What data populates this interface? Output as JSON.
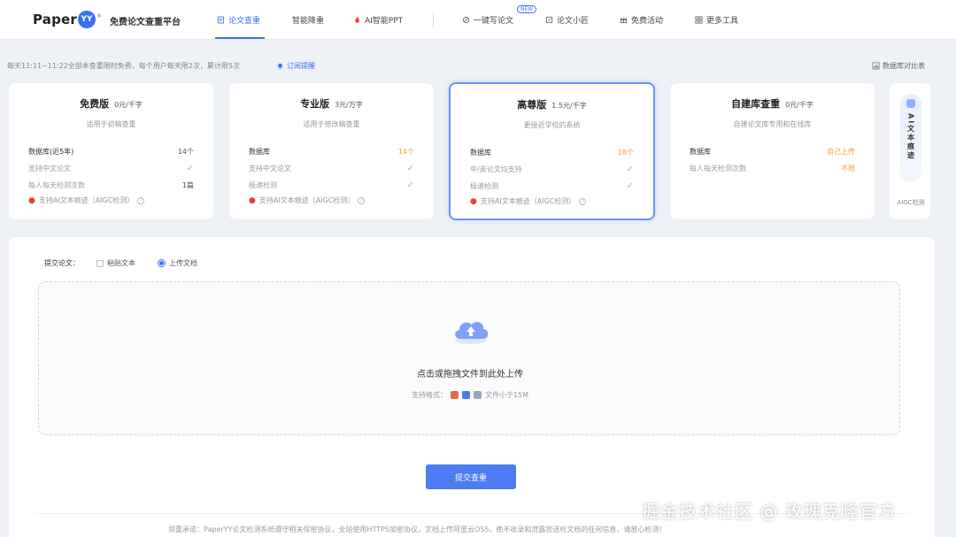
{
  "header": {
    "logo_text": "Paper",
    "logo_badge": "YY",
    "logo_reg": "®",
    "platform_name": "免费论文查重平台",
    "nav": [
      {
        "label": "论文查重",
        "icon": "document-icon",
        "active": true
      },
      {
        "label": "智能降重",
        "icon": "",
        "active": false
      },
      {
        "label": "AI智能PPT",
        "icon": "fire-icon",
        "active": false
      },
      {
        "label": "一键写论文",
        "icon": "pen-icon",
        "active": false,
        "badge": "NEW"
      },
      {
        "label": "论文小匠",
        "icon": "edit-icon",
        "active": false
      },
      {
        "label": "免费活动",
        "icon": "gift-icon",
        "active": false
      },
      {
        "label": "更多工具",
        "icon": "grid-icon",
        "active": false
      }
    ]
  },
  "notice": {
    "text": "每天11:11~11:22全部本查重限时免费，每个用户每天限2次，累计限5次",
    "link": "订阅提醒",
    "compare": "数据库对比表"
  },
  "cards": [
    {
      "title": "免费版",
      "price": "0元/千字",
      "subtitle": "适用于初稿查重",
      "rows": [
        {
          "k": "数据库(近5年)",
          "v": "14个",
          "strong": true,
          "vtype": "plain"
        },
        {
          "k": "支持中文论文",
          "v": "✓",
          "vtype": "check"
        },
        {
          "k": "每人每天检测次数",
          "v": "1篇",
          "vtype": "plain"
        }
      ],
      "aigc": "支持AI文本痕迹（AIGC检测）"
    },
    {
      "title": "专业版",
      "price": "3元/万字",
      "subtitle": "适用于修改稿查重",
      "rows": [
        {
          "k": "数据库",
          "v": "14个",
          "strong": true,
          "vtype": "orange"
        },
        {
          "k": "支持中文论文",
          "v": "✓",
          "vtype": "check"
        },
        {
          "k": "极速检测",
          "v": "✓",
          "vtype": "check"
        }
      ],
      "aigc": "支持AI文本痕迹（AIGC检测）"
    },
    {
      "title": "高尊版",
      "price": "1.5元/千字",
      "subtitle": "更接近学校的系统",
      "rows": [
        {
          "k": "数据库",
          "v": "18个",
          "strong": true,
          "vtype": "orange"
        },
        {
          "k": "中/英论文均支持",
          "v": "✓",
          "vtype": "check"
        },
        {
          "k": "极速检测",
          "v": "✓",
          "vtype": "check"
        }
      ],
      "aigc": "支持AI文本痕迹（AIGC检测）"
    },
    {
      "title": "自建库查重",
      "price": "0元/千字",
      "subtitle": "自建论文库专用和在线库",
      "rows": [
        {
          "k": "数据库",
          "v": "自己上传",
          "strong": true,
          "vtype": "orange"
        },
        {
          "k": "每人每天检测次数",
          "v": "不限",
          "vtype": "orange"
        }
      ],
      "aigc": ""
    }
  ],
  "ai_card": {
    "label": "AI文本痕迹",
    "foot": "AIGC检测"
  },
  "main": {
    "submit_label": "提交论文：",
    "option_paste": "粘贴文本",
    "option_upload": "上传文档",
    "drop_title": "点击或拖拽文件到此处上传",
    "formats_label": "支持格式：",
    "formats_note": "文件小于15M",
    "submit_button": "提交查重",
    "disclaimer": "郑重承诺：PaperYY论文检测系统遵守相关保密协议，全站使用HTTPS加密协议，文档上传阿里云OSS，绝不收录和泄露您送检文档的任何信息，请放心检测！"
  },
  "watermark": "掘金技术社区 @ 玫瑰克隆官方",
  "colors": {
    "accent": "#3b6ff5",
    "orange": "#f0a030",
    "check": "#9cc36a",
    "fire": "#e8412f"
  }
}
